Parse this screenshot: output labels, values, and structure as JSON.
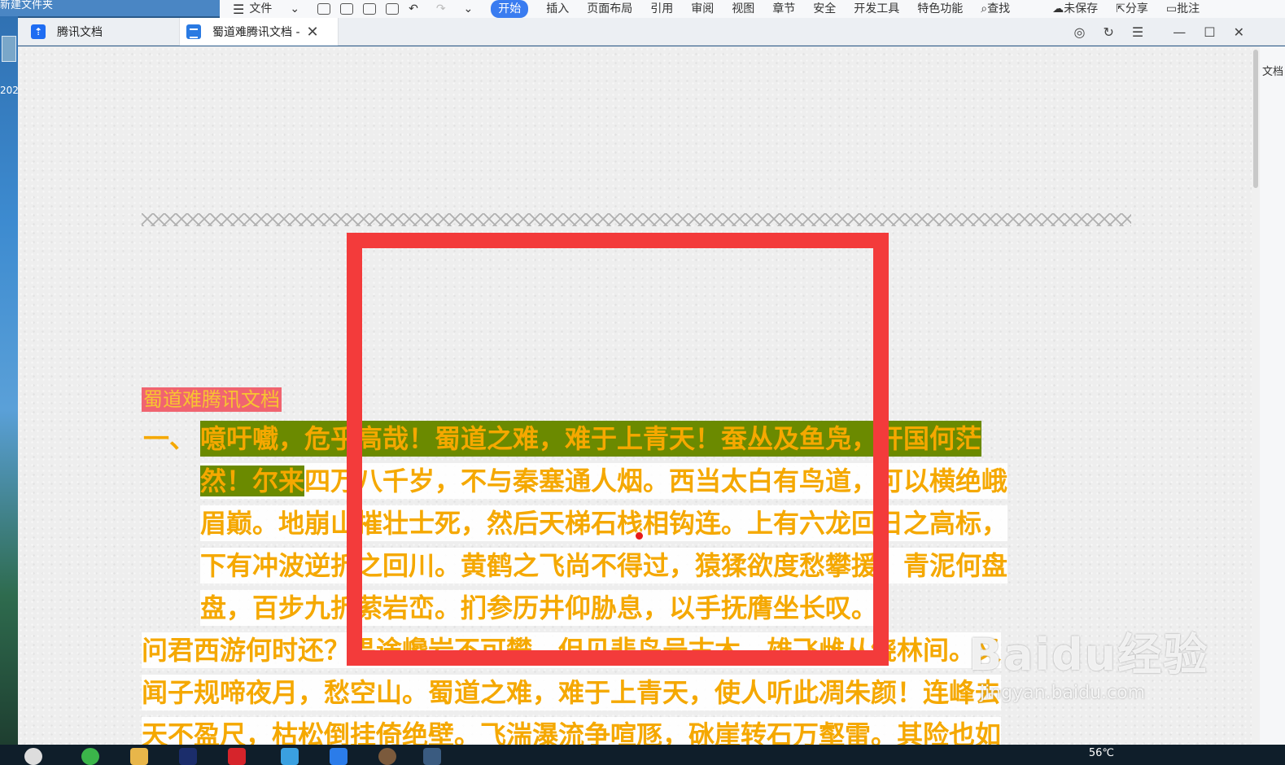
{
  "desktop": {
    "folder_label": "新建文件夹",
    "year_label": "202"
  },
  "ribbon": {
    "file_menu": "文件",
    "tabs": [
      "开始",
      "插入",
      "页面布局",
      "引用",
      "审阅",
      "视图",
      "章节",
      "安全",
      "开发工具",
      "特色功能"
    ],
    "active_tab": "开始",
    "search": "查找",
    "unsaved": "未保存",
    "share": "分享",
    "comment": "批注"
  },
  "tabs": [
    {
      "label": "腾讯文档"
    },
    {
      "label": "蜀道难腾讯文档 -"
    }
  ],
  "right_panel_label": "文档",
  "document": {
    "title": "蜀道难腾讯文档",
    "item_prefix": "一、",
    "lines": [
      "噫吁嚱，危乎高哉！蜀道之难，难于上青天！蚕丛及鱼凫，开国何茫",
      "然！尔来四万八千岁，不与秦塞通人烟。西当太白有鸟道，可以横绝峨",
      "眉巅。地崩山摧壮士死，然后天梯石栈相钩连。上有六龙回日之高标，",
      "下有冲波逆折之回川。黄鹤之飞尚不得过，猿猱欲度愁攀援。青泥何盘",
      "盘，百步九折萦岩峦。扪参历井仰胁息，以手抚膺坐长叹。"
    ],
    "continued_lines": [
      "问君西游何时还？畏途巉岩不可攀。但见悲鸟号古木，雄飞雌从绕林间。又",
      "闻子规啼夜月，愁空山。蜀道之难，难于上青天，使人听此凋朱颜！连峰去",
      "天不盈尺，枯松倒挂倚绝壁。飞湍瀑流争喧豗，砯崖转石万壑雷。其险也如"
    ],
    "highlight_first_part": "然！尔来"
  },
  "watermark": {
    "brand": "Baidu经验",
    "url": "jingyan.baidu.com"
  },
  "taskbar": {
    "temperature": "56℃"
  },
  "colors": {
    "text": "#f5a800",
    "highlight": "#6b8a00",
    "title_bg": "#f06470",
    "annotation_box": "#f33b3b",
    "ribbon_active": "#3a7cf0"
  }
}
